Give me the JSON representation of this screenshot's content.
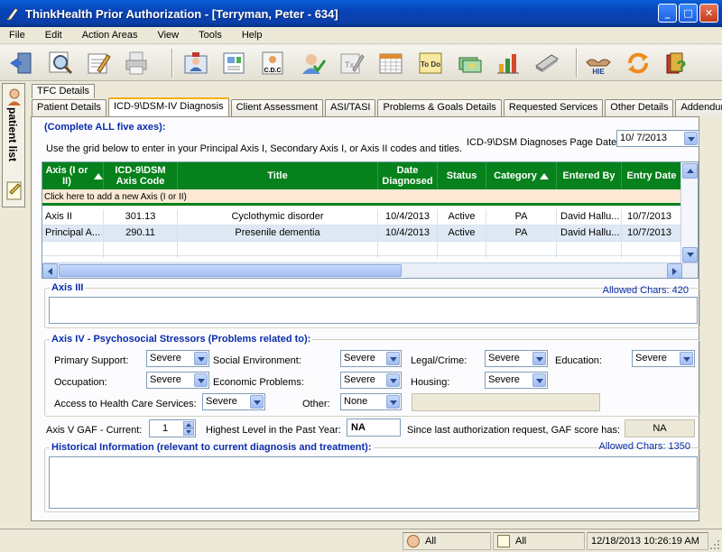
{
  "window": {
    "title": "ThinkHealth Prior Authorization  - [Terryman, Peter - 634]",
    "controls": [
      "minimize",
      "maximize",
      "close"
    ]
  },
  "menu": [
    "File",
    "Edit",
    "Action Areas",
    "View",
    "Tools",
    "Help"
  ],
  "toolbar": {
    "icons": [
      "exit-icon",
      "search-icon",
      "review-icon",
      "print-icon",
      "consumer-icon",
      "chart-icon",
      "cdc-icon",
      "authorize-icon",
      "tx-icon",
      "calendar-icon",
      "todo-icon",
      "money-icon",
      "report-icon",
      "scanner-icon",
      "hie-icon",
      "refresh-icon",
      "help-icon"
    ],
    "labels": {
      "cdc": "C.D.C",
      "hie": "HIE",
      "todo": "To Do"
    }
  },
  "side": {
    "label": "patient list"
  },
  "tabs": {
    "top": "TFC Details",
    "items": [
      "Patient Details",
      "ICD-9\\DSM-IV Diagnosis",
      "Client Assessment",
      "ASI/TASI",
      "Problems & Goals Details",
      "Requested Services",
      "Other Details",
      "Addendum"
    ],
    "active": "ICD-9\\DSM-IV Diagnosis"
  },
  "diagnosis": {
    "heading": "(Complete ALL five axes):",
    "instruction": "Use the grid below to enter in your Principal Axis I, Secondary Axis I, or Axis II codes and titles.",
    "page_date_label": "ICD-9\\DSM Diagnoses Page Date:",
    "page_date": "10/  7/2013",
    "grid": {
      "columns": [
        "Axis (I or II)",
        "ICD-9\\DSM Axis Code",
        "Title",
        "Date Diagnosed",
        "Status",
        "Category",
        "Entered By",
        "Entry Date"
      ],
      "add_row_text": "Click here to add a new Axis (I or II)",
      "rows": [
        {
          "axis": "Axis II",
          "code": "301.13",
          "title": "Cyclothymic disorder",
          "date": "10/4/2013",
          "status": "Active",
          "category": "PA",
          "entered_by": "David Hallu...",
          "entry_date": "10/7/2013"
        },
        {
          "axis": "Principal A...",
          "code": "290.11",
          "title": "Presenile dementia",
          "date": "10/4/2013",
          "status": "Active",
          "category": "PA",
          "entered_by": "David Hallu...",
          "entry_date": "10/7/2013"
        }
      ]
    },
    "axis3": {
      "title": "Axis III",
      "allowed": "Allowed Chars: 420",
      "value": ""
    },
    "axis4": {
      "title": "Axis IV - Psychosocial Stressors (Problems related to):",
      "fields": [
        {
          "label": "Primary Support:",
          "value": "Severe"
        },
        {
          "label": "Social Environment:",
          "value": "Severe"
        },
        {
          "label": "Legal/Crime:",
          "value": "Severe"
        },
        {
          "label": "Education:",
          "value": "Severe"
        },
        {
          "label": "Occupation:",
          "value": "Severe"
        },
        {
          "label": "Economic Problems:",
          "value": "Severe"
        },
        {
          "label": "Housing:",
          "value": "Severe"
        },
        {
          "label": "Access to Health Care Services:",
          "value": "Severe"
        },
        {
          "label": "Other:",
          "value": "None"
        }
      ],
      "other_text": ""
    },
    "axis5": {
      "gaf_label": "Axis V GAF - Current:",
      "gaf_value": "1",
      "highest_label": "Highest Level in the Past Year:",
      "highest_value": "NA",
      "since_label": "Since last authorization request, GAF score has:",
      "since_value": "NA"
    },
    "historical": {
      "title": "Historical Information (relevant to current diagnosis and treatment):",
      "allowed": "Allowed Chars: 1350",
      "value": ""
    }
  },
  "status_bar": {
    "consumer_filter": "All",
    "notes_filter": "All",
    "datetime": "12/18/2013 10:26:19 AM"
  }
}
